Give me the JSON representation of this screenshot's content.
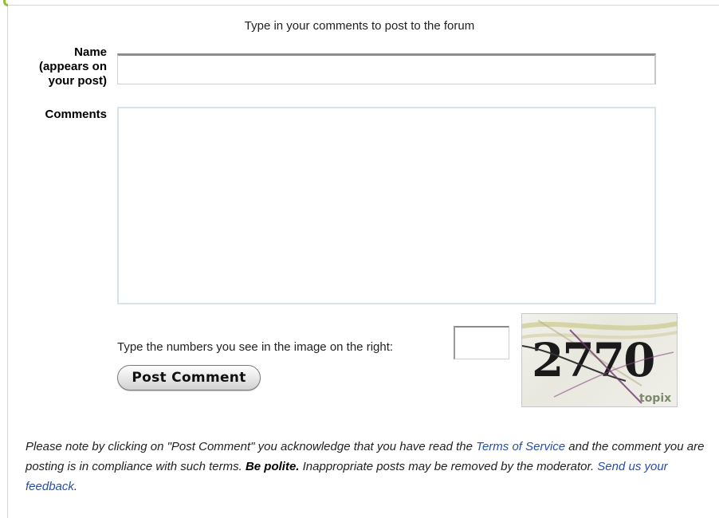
{
  "form": {
    "heading": "Type in your comments to post to the forum",
    "name_label_line1": "Name",
    "name_label_line2": "(appears on",
    "name_label_line3": "your post)",
    "name_value": "",
    "comments_label": "Comments",
    "comments_value": "",
    "captcha_prompt": "Type the numbers you see in the image on the right:",
    "captcha_value": "",
    "submit_label": "Post Comment"
  },
  "captcha": {
    "digits": "2770",
    "brand": "topix"
  },
  "notice": {
    "part1": "Please note by clicking on \"Post Comment\" you acknowledge that you have read the ",
    "tos_link": "Terms of Service",
    "part2": " and the comment you are posting is in compliance with such terms. ",
    "polite": "Be polite.",
    "part3": " Inappropriate posts may be removed by the moderator. ",
    "feedback_link": "Send us your feedback",
    "part4": "."
  },
  "colors": {
    "link": "#2a4f9e",
    "accent": "#8fbf3a"
  }
}
